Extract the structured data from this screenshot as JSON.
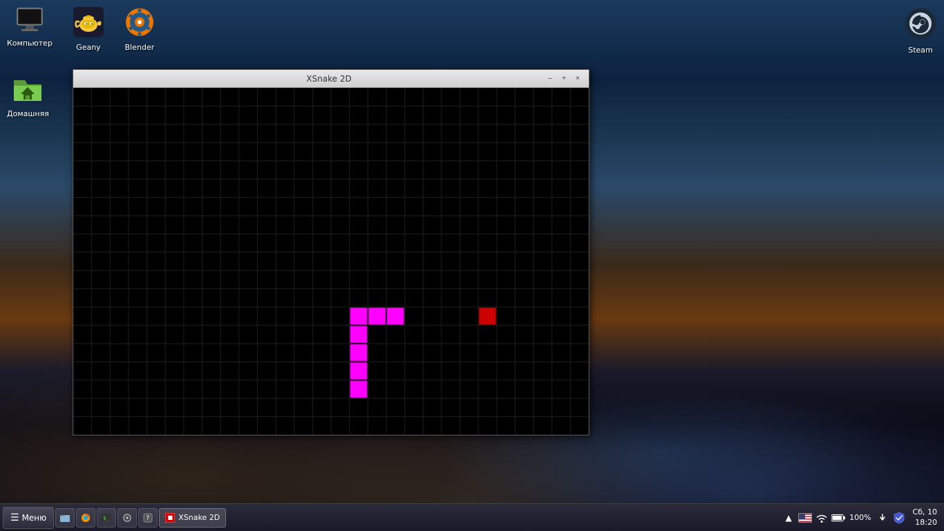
{
  "desktop": {
    "background_description": "city night skyline with sunset"
  },
  "desktop_icons": {
    "top_row": [
      {
        "id": "computer",
        "label": "Компьютер",
        "icon_type": "monitor"
      },
      {
        "id": "geany",
        "label": "Geany",
        "icon_type": "geany"
      },
      {
        "id": "blender",
        "label": "Blender",
        "icon_type": "blender"
      }
    ],
    "left_col": [
      {
        "id": "home",
        "label": "Домашняя",
        "icon_type": "home"
      }
    ],
    "top_right": [
      {
        "id": "steam",
        "label": "Steam",
        "icon_type": "steam"
      }
    ]
  },
  "window": {
    "title": "XSnake 2D",
    "controls": {
      "minimize": "–",
      "maximize": "+",
      "close": "×"
    }
  },
  "game": {
    "grid_cols": 28,
    "grid_rows": 19,
    "snake_color": "#ff00ff",
    "food_color": "#cc0000",
    "snake_cells": [
      [
        17,
        12
      ],
      [
        16,
        12
      ],
      [
        15,
        12
      ],
      [
        15,
        13
      ],
      [
        15,
        14
      ],
      [
        15,
        15
      ],
      [
        15,
        16
      ]
    ],
    "food_cell": [
      22,
      12
    ]
  },
  "taskbar": {
    "menu_label": "Меню",
    "apps": [
      "file-manager",
      "firefox",
      "terminal",
      "settings",
      "unknown"
    ],
    "windows": [
      {
        "label": "XSnake 2D",
        "icon": "red-square"
      }
    ],
    "tray": {
      "chevron": "▲",
      "flag": "US",
      "wifi": "📶",
      "battery": "🔋",
      "battery_percent": "100%",
      "update_arrow": "↓",
      "shield": true,
      "clock_date": "Сб, 10",
      "clock_time": "18:20"
    }
  }
}
